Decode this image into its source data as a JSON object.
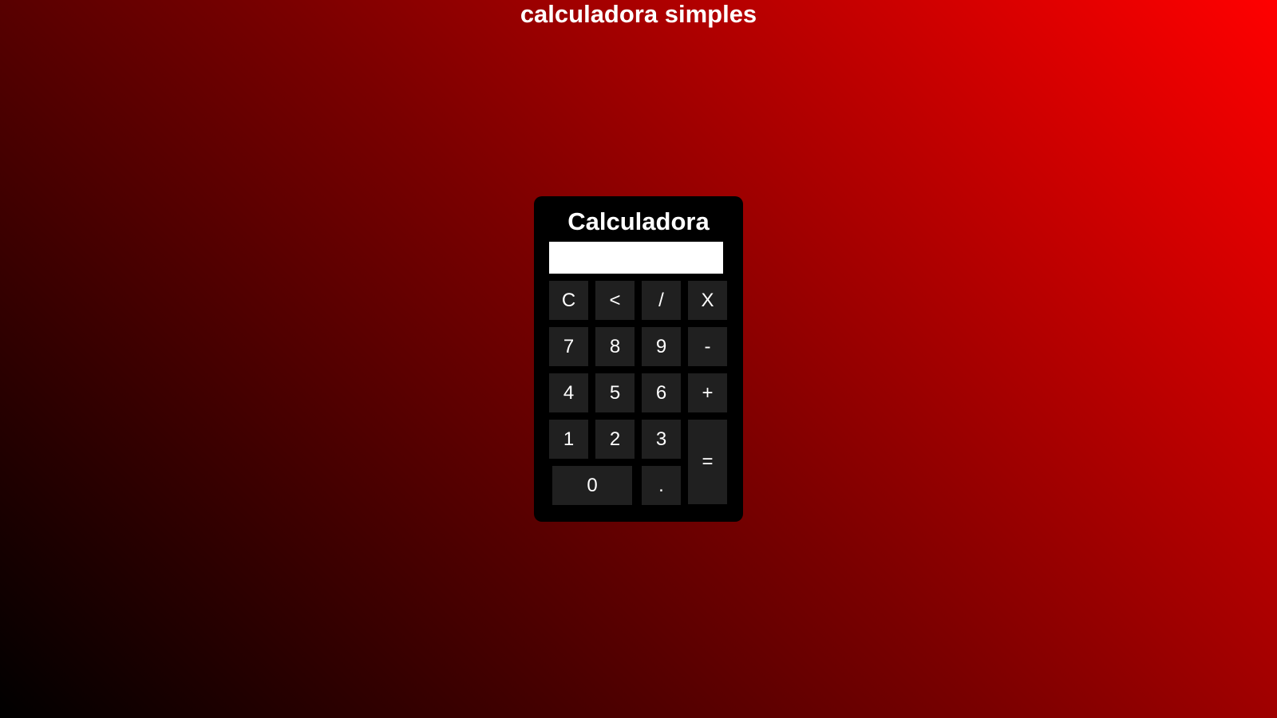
{
  "page": {
    "heading": "calculadora simples"
  },
  "calculator": {
    "title": "Calculadora",
    "display_value": "",
    "keys": {
      "clear": "C",
      "backspace": "<",
      "divide": "/",
      "multiply": "X",
      "seven": "7",
      "eight": "8",
      "nine": "9",
      "minus": "-",
      "four": "4",
      "five": "5",
      "six": "6",
      "plus": "+",
      "one": "1",
      "two": "2",
      "three": "3",
      "equals": "=",
      "zero": "0",
      "decimal": "."
    }
  },
  "colors": {
    "gradient_start": "#000000",
    "gradient_end": "#ff0000",
    "calculator_body": "#000000",
    "key_background": "#202020",
    "display_background": "#ffffff",
    "text": "#ffffff"
  }
}
